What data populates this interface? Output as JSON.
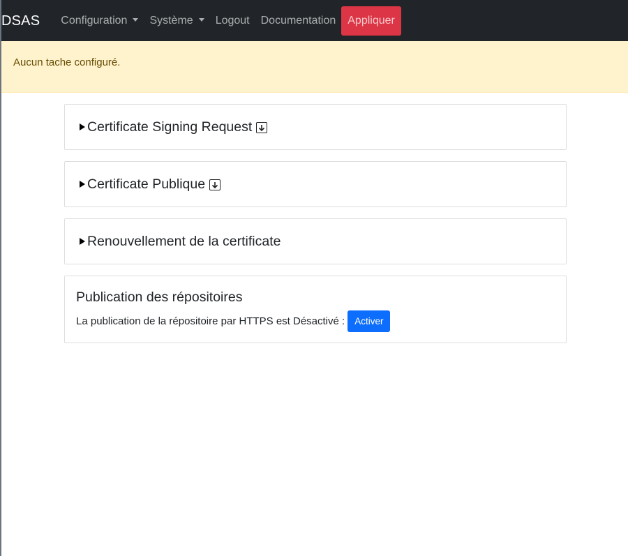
{
  "navbar": {
    "brand": "DSAS",
    "items": [
      {
        "label": "Configuration",
        "dropdown": true
      },
      {
        "label": "Système",
        "dropdown": true
      },
      {
        "label": "Logout",
        "dropdown": false
      },
      {
        "label": "Documentation",
        "dropdown": false
      }
    ],
    "apply_label": "Appliquer"
  },
  "alert": {
    "message": "Aucun tache configuré."
  },
  "cards": {
    "csr": {
      "title": "Certificate Signing Request",
      "icon": "download-icon"
    },
    "public_cert": {
      "title": "Certificate Publique",
      "icon": "download-icon"
    },
    "renewal": {
      "title": "Renouvellement de la certificate"
    },
    "publication": {
      "title": "Publication des répositoires",
      "text": "La publication de la répositoire par HTTPS est Désactivé :",
      "button_label": "Activer"
    }
  },
  "colors": {
    "navbar_bg": "#212529",
    "apply_bg": "#dc3545",
    "alert_bg": "#fff3cd",
    "alert_text": "#664d03",
    "primary": "#0d6efd"
  }
}
